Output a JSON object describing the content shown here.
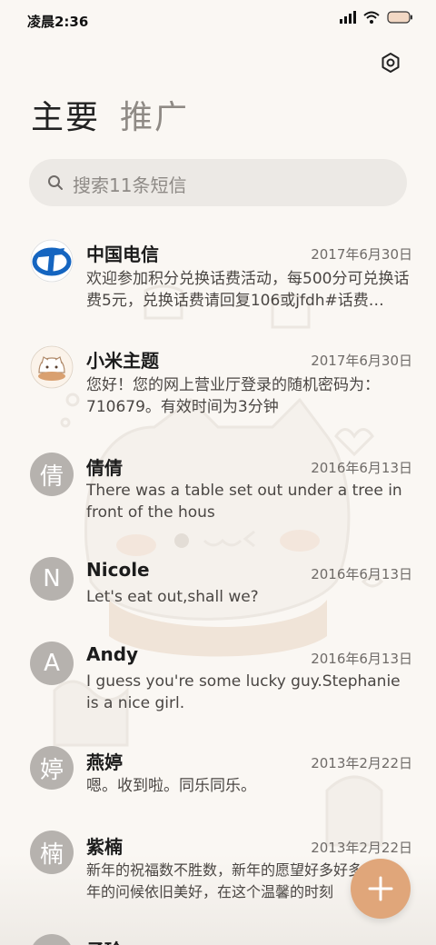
{
  "status_bar": {
    "time": "凌晨2:36"
  },
  "tabs": [
    {
      "label": "主要",
      "active": true
    },
    {
      "label": "推广",
      "active": false
    }
  ],
  "search": {
    "placeholder": "搜索11条短信"
  },
  "conversations": [
    {
      "sender": "中国电信",
      "date": "2017年6月30日",
      "preview": "欢迎参加积分兑换话费活动，每500分可兑换话费5元，兑换话费请回复106或jfdh#话费…",
      "avatar_type": "telecom-logo-icon"
    },
    {
      "sender": "小米主题",
      "date": "2017年6月30日",
      "preview": "您好！您的网上营业厅登录的随机密码为：710679。有效时间为3分钟",
      "avatar_type": "cat-icon"
    },
    {
      "sender": "倩倩",
      "date": "2016年6月13日",
      "preview": "There was a table set out under a tree in front of the hous",
      "avatar_letter": "倩"
    },
    {
      "sender": "Nicole",
      "date": "2016年6月13日",
      "preview": "Let's eat out,shall we?",
      "avatar_letter": "N"
    },
    {
      "sender": "Andy",
      "date": "2016年6月13日",
      "preview": "I guess you're some lucky guy.Stephanie is a nice girl.",
      "avatar_letter": "A"
    },
    {
      "sender": "燕婷",
      "date": "2013年2月22日",
      "preview": "嗯。收到啦。同乐同乐。",
      "avatar_letter": "婷"
    },
    {
      "sender": "紫楠",
      "date": "2013年2月22日",
      "preview": "新年的祝福数不胜数，新年的愿望好多好多，新年的问候依旧美好，在这个温馨的时刻",
      "avatar_letter": "楠"
    },
    {
      "sender": "子玲",
      "date": "",
      "preview": "",
      "avatar_letter": ""
    }
  ],
  "colors": {
    "fab": "#e0a67a",
    "avatar": "#b6b2ae",
    "background": "#faf7f3"
  }
}
